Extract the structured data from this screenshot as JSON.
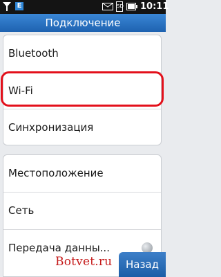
{
  "status_bar": {
    "network_badge": "E",
    "time": "10:11",
    "sd_label": "SD",
    "icons": [
      "signal-icon",
      "mail-icon",
      "sd-card-icon",
      "battery-icon"
    ]
  },
  "title": "Подключение",
  "group1": {
    "items": [
      {
        "label": "Bluetooth"
      },
      {
        "label": "Wi-Fi"
      },
      {
        "label": "Синхронизация"
      }
    ]
  },
  "group2": {
    "items": [
      {
        "label": "Местоположение"
      },
      {
        "label": "Сеть"
      },
      {
        "label": "Передача данны..."
      }
    ]
  },
  "watermark": "Botvet.ru",
  "back_button": "Назад",
  "colors": {
    "title_bar": "#2a73c4",
    "highlight": "#e3101b",
    "back_button": "#2a6db8"
  }
}
